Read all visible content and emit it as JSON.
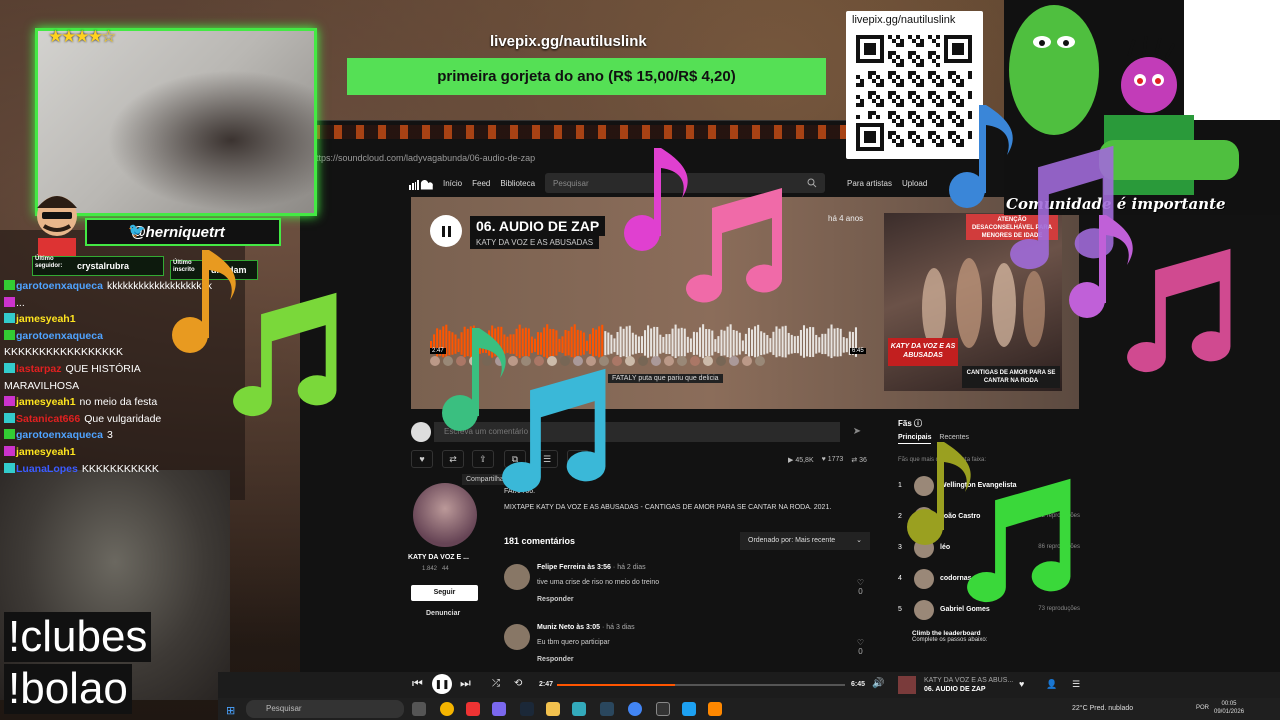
{
  "stream": {
    "banner": {
      "url": "livepix.gg/nautiluslink",
      "message": "primeira gorjeta do ano (R$ 15,00/R$ 4,20)"
    },
    "qr": {
      "url": "livepix.gg/nautiluslink"
    },
    "community_text": "Comunidade é importante",
    "twitter_handle": "@herniquetrt",
    "last_follower": {
      "label": "Último seguidor:",
      "name": "crystalrubra"
    },
    "last_sub": {
      "label": "Último inscrito",
      "name": "druidam"
    },
    "rating_stars": 4.5,
    "commands": [
      "!clubes",
      "!bolao"
    ],
    "chat": [
      {
        "user": "garotoenxaqueca",
        "color": "#4fa3ff",
        "text": "kkkkkkkkkkkkkkkkkkkk"
      },
      {
        "user": "",
        "color": "#e02020",
        "text": "..."
      },
      {
        "user": "jamesyeah1",
        "color": "#ffe51f",
        "text": ""
      },
      {
        "user": "garotoenxaqueca",
        "color": "#4fa3ff",
        "text": ""
      },
      {
        "user": "",
        "color": "#ffffff",
        "text": "KKKKKKKKKKKKKKKKK"
      },
      {
        "user": "lastarpaz",
        "color": "#e02020",
        "text": "QUE HISTÓRIA"
      },
      {
        "user": "",
        "color": "#ffffff",
        "text": "MARAVILHOSA"
      },
      {
        "user": "jamesyeah1",
        "color": "#ffe51f",
        "text": "no meio da festa"
      },
      {
        "user": "Satanicat666",
        "color": "#e02020",
        "text": "Que vulgaridade"
      },
      {
        "user": "garotoenxaqueca",
        "color": "#4fa3ff",
        "text": "3"
      },
      {
        "user": "jamesyeah1",
        "color": "#ffe51f",
        "text": ""
      },
      {
        "user": "LuanaLopes",
        "color": "#3b5bff",
        "text": "KKKKKKKKKKK"
      }
    ]
  },
  "browser": {
    "url": "https://soundcloud.com/ladyvagabunda/06-audio-de-zap",
    "nav": {
      "links": [
        "Início",
        "Feed",
        "Biblioteca"
      ],
      "search_placeholder": "Pesquisar",
      "for_artists": "Para artistas",
      "upload": "Upload"
    }
  },
  "track": {
    "title": "06. AUDIO DE ZAP",
    "artist": "KATY DA VOZ E AS ABUSADAS",
    "age": "há 4 anos",
    "time_current": "2:47",
    "time_total": "6:45",
    "progress_fraction": 0.41,
    "wave_comment_user": "FATALY",
    "wave_comment": "puta que pariu que delicia",
    "cover": {
      "sign": "ATENÇÃO DESACONSELHÁVEL PARA MENORES DE IDADE",
      "title_badge": "KATY DA VOZ E AS ABUSADAS",
      "subtitle_badge": "CANTIGAS DE AMOR PARA SE CANTAR NA RODA"
    },
    "comment_placeholder": "Escreva um comentário",
    "share_tooltip": "Compartilhar",
    "stats": {
      "plays": "45,8K",
      "likes": "1773",
      "reposts": "36"
    },
    "faixa": "FAIXA 06.",
    "description": "MIXTAPE KATY DA VOZ E AS ABUSADAS - CANTIGAS DE AMOR PARA SE CANTAR NA RODA. 2021.",
    "comments_count": "181 comentários",
    "sort_label": "Ordenado por: Mais recente"
  },
  "artist": {
    "name": "KATY DA VOZ E ...",
    "followers": "1.842",
    "tracks": "44",
    "follow_label": "Seguir",
    "report_label": "Denunciar"
  },
  "comments": [
    {
      "user": "Felipe Ferreira",
      "at": "3:56",
      "when": "há 2 dias",
      "text": "tive uma crise de riso no meio do treino",
      "reply": "Responder",
      "likes": "0"
    },
    {
      "user": "Muniz Neto",
      "at": "3:05",
      "when": "há 3 dias",
      "text": "Eu tbm quero participar",
      "reply": "Responder",
      "likes": "0"
    }
  ],
  "fans": {
    "title": "Fãs",
    "tabs": [
      "Principais",
      "Recentes"
    ],
    "subtitle": "Fãs que mais ouviram esta faixa:",
    "list": [
      {
        "rank": "1",
        "name": "Wellington Evangelista",
        "plays": ""
      },
      {
        "rank": "2",
        "name": "João Castro",
        "plays": "92 reproduções"
      },
      {
        "rank": "3",
        "name": "léo",
        "plays": "86 reproduções"
      },
      {
        "rank": "4",
        "name": "codornas",
        "plays": ""
      },
      {
        "rank": "5",
        "name": "Gabriel Gomes",
        "plays": "73 reproduções"
      }
    ],
    "leader_title": "Climb the leaderboard",
    "leader_sub": "Complete os passos abaixo:"
  },
  "player": {
    "time_current": "2:47",
    "time_total": "6:45",
    "artist": "KATY DA VOZ E AS ABUS...",
    "title": "06. AUDIO DE ZAP"
  },
  "taskbar": {
    "search_placeholder": "Pesquisar",
    "weather": "22°C  Pred. nublado",
    "lang": "POR",
    "time": "00:05",
    "date": "09/01/2026"
  },
  "colors": {
    "accent_green": "#44e944",
    "soundcloud_orange": "#ff5500",
    "banner_green": "#55e055"
  }
}
